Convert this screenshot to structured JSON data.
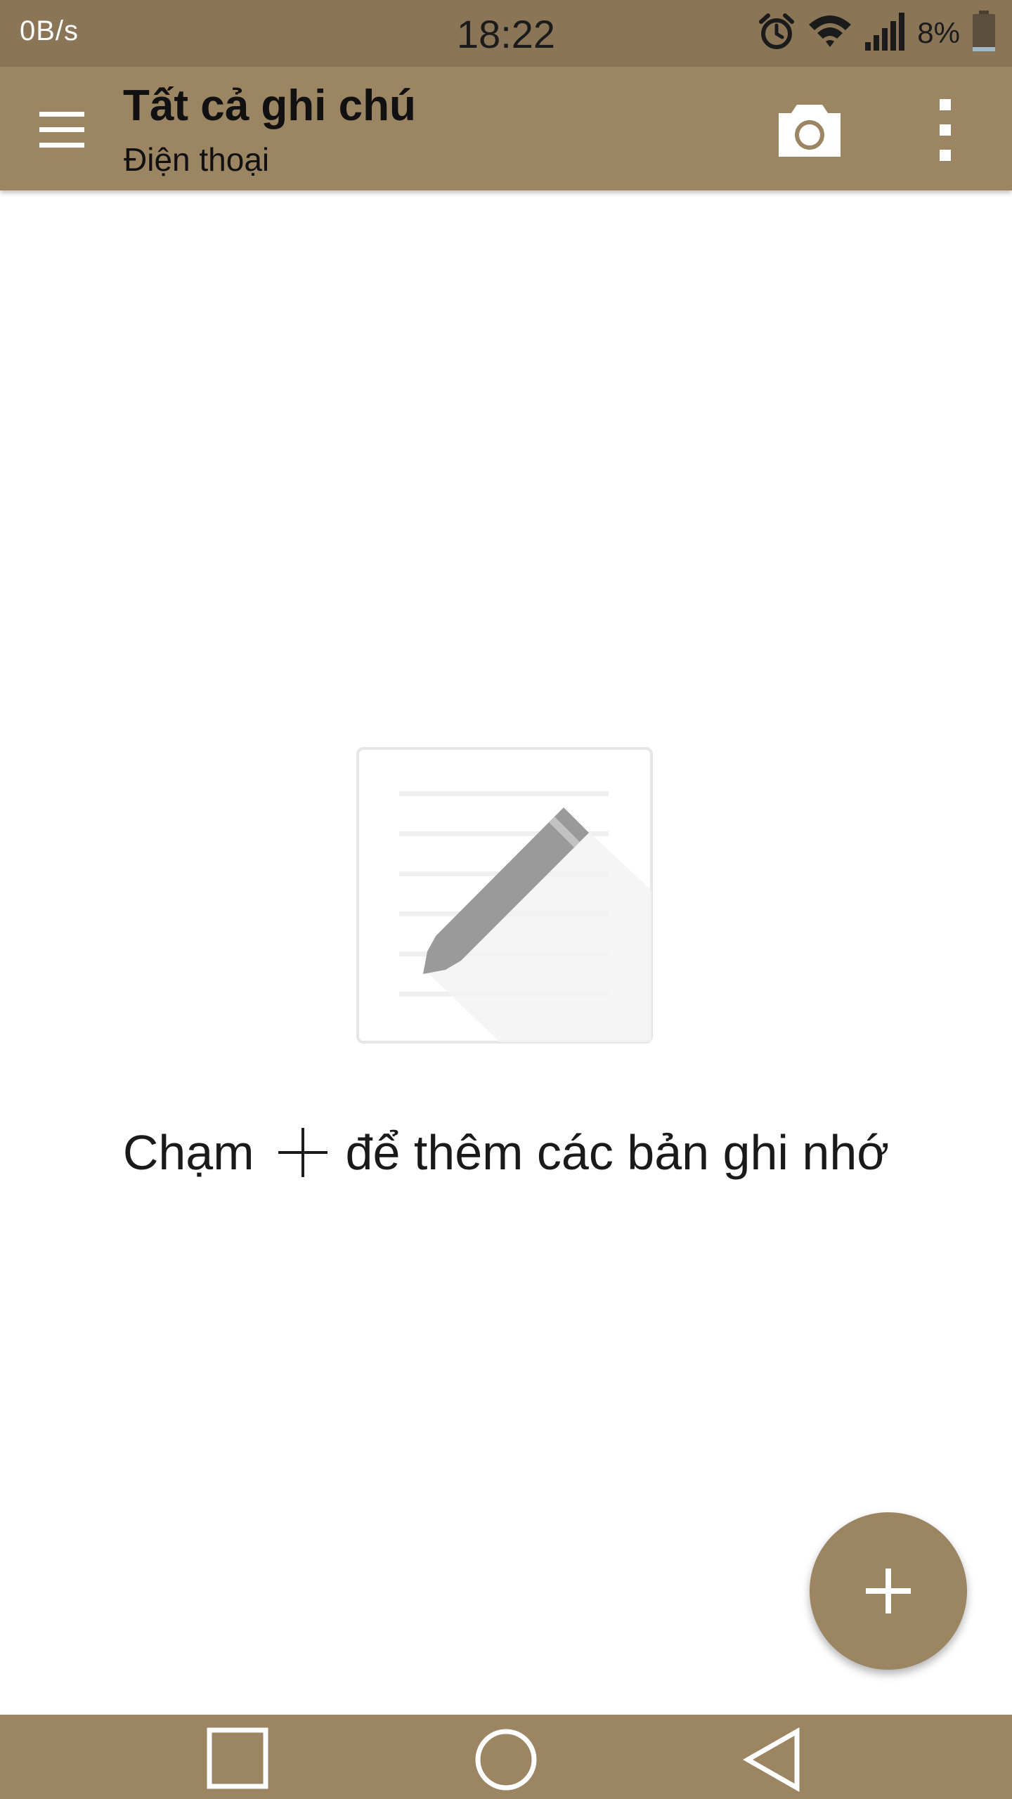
{
  "status_bar": {
    "network_speed": "0B/s",
    "time": "18:22",
    "battery_percent": "8%",
    "icons": [
      "alarm-icon",
      "wifi-icon",
      "signal-icon",
      "battery-icon"
    ]
  },
  "app_bar": {
    "title": "Tất cả ghi chú",
    "subtitle": "Điện thoại",
    "icons": [
      "menu-icon",
      "camera-icon",
      "overflow-menu-icon"
    ]
  },
  "empty_state": {
    "message_before": "Chạm",
    "message_after": "để thêm các bản ghi nhớ",
    "icons": [
      "note-pencil-illustration",
      "plus-icon"
    ]
  },
  "fab": {
    "icon": "plus-icon"
  },
  "nav_bar": {
    "icons": [
      "recents-icon",
      "home-icon",
      "back-icon"
    ]
  },
  "colors": {
    "status_bar": "#8a7657",
    "accent": "#9b8563",
    "text": "#111111",
    "background": "#ffffff"
  }
}
